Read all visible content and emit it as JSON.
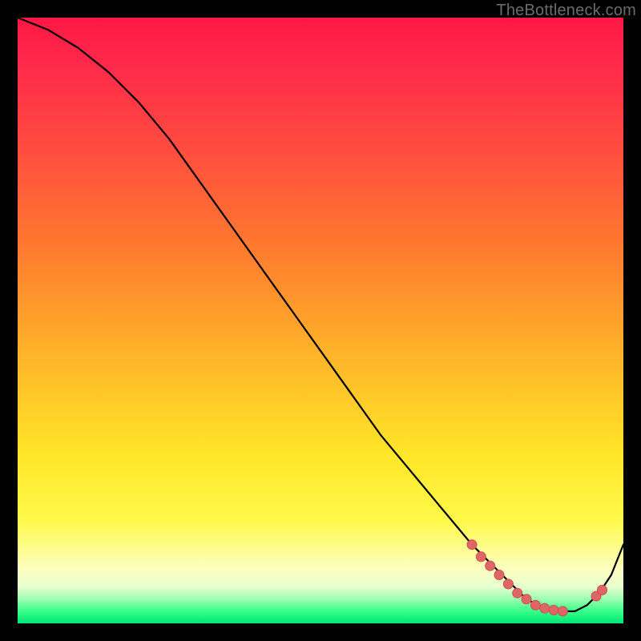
{
  "watermark": "TheBottleneck.com",
  "colors": {
    "background": "#000000",
    "curve": "#000000",
    "dot_fill": "#e06666",
    "dot_stroke": "#c94f4f"
  },
  "chart_data": {
    "type": "line",
    "title": "",
    "xlabel": "",
    "ylabel": "",
    "xlim": [
      0,
      100
    ],
    "ylim": [
      0,
      100
    ],
    "series": [
      {
        "name": "curve",
        "x": [
          0,
          5,
          10,
          15,
          20,
          25,
          30,
          35,
          40,
          45,
          50,
          55,
          60,
          65,
          70,
          75,
          78,
          80,
          82,
          84,
          86,
          88,
          90,
          92,
          94,
          96,
          98,
          100
        ],
        "y": [
          100,
          98,
          95,
          91,
          86,
          80,
          73,
          66,
          59,
          52,
          45,
          38,
          31,
          25,
          19,
          13,
          10,
          8,
          6,
          4,
          3,
          2,
          2,
          2,
          3,
          5,
          8,
          13
        ]
      }
    ],
    "dots": [
      {
        "x": 75.0,
        "y": 13.0
      },
      {
        "x": 76.5,
        "y": 11.0
      },
      {
        "x": 78.0,
        "y": 9.5
      },
      {
        "x": 79.5,
        "y": 8.0
      },
      {
        "x": 81.0,
        "y": 6.5
      },
      {
        "x": 82.5,
        "y": 5.0
      },
      {
        "x": 84.0,
        "y": 4.0
      },
      {
        "x": 85.5,
        "y": 3.0
      },
      {
        "x": 87.0,
        "y": 2.5
      },
      {
        "x": 88.5,
        "y": 2.2
      },
      {
        "x": 90.0,
        "y": 2.0
      },
      {
        "x": 95.5,
        "y": 4.5
      },
      {
        "x": 96.5,
        "y": 5.5
      }
    ]
  }
}
